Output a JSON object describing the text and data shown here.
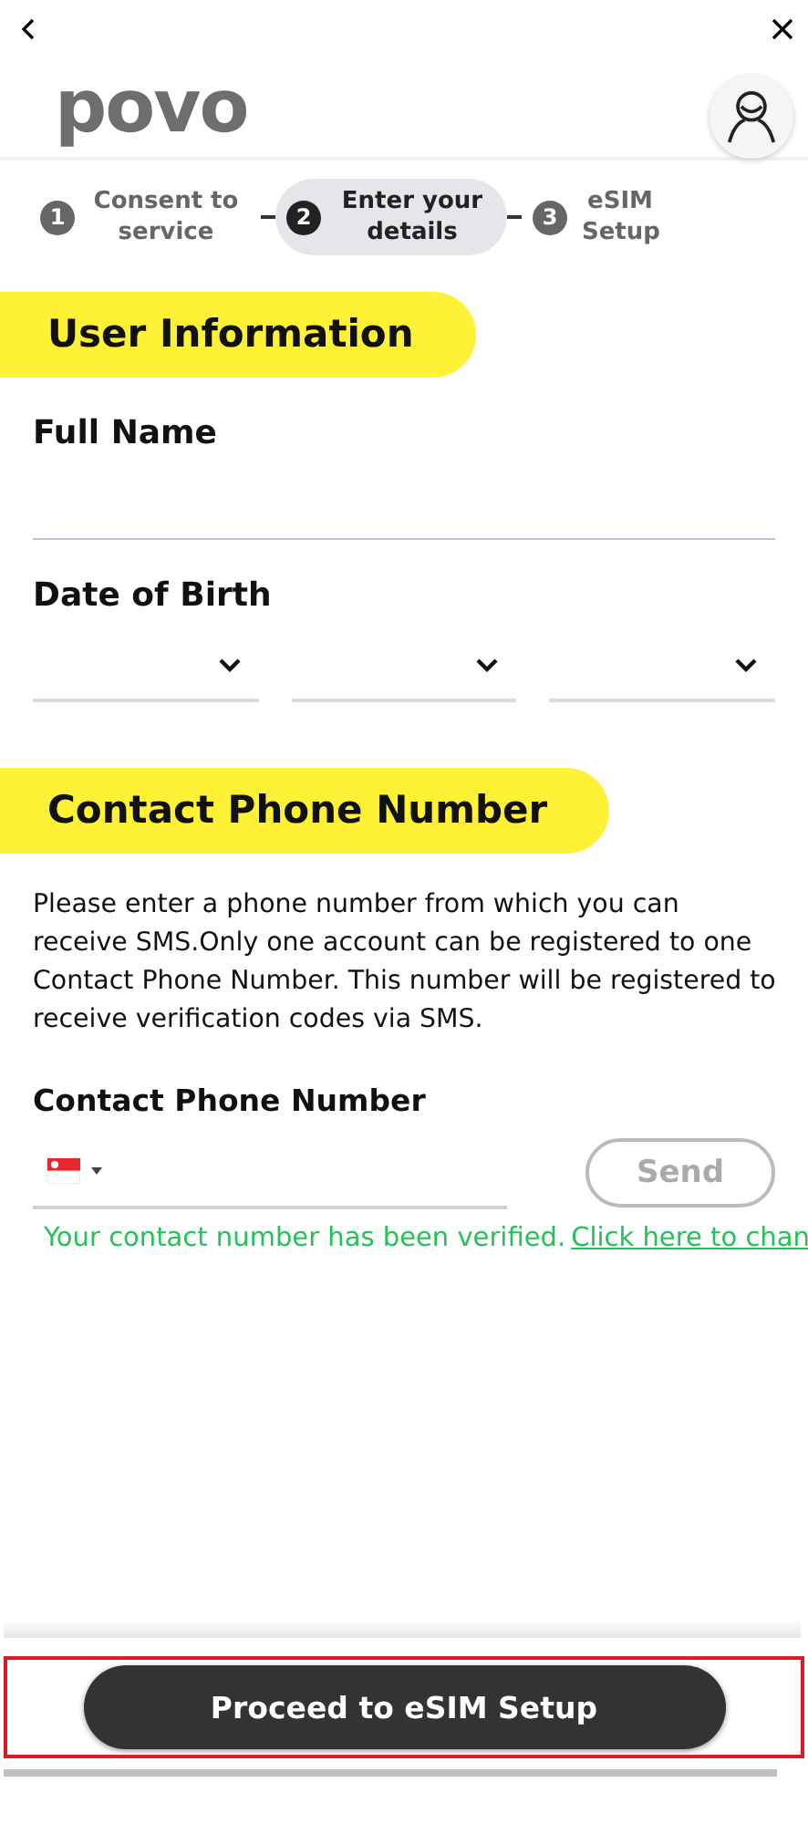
{
  "logo": "povo",
  "steps": [
    {
      "number": "1",
      "label": "Consent to service",
      "selected": false
    },
    {
      "number": "2",
      "label": "Enter your details",
      "selected": true
    },
    {
      "number": "3",
      "label": "eSIM Setup",
      "selected": false
    }
  ],
  "sections": [
    {
      "title": "User Information"
    },
    {
      "title": "Contact Phone Number"
    }
  ],
  "full_name": {
    "label": "Full Name"
  },
  "date_of_birth": {
    "label": "Date of Birth"
  },
  "contact": {
    "description": "Please enter a phone number from which you can receive SMS.Only one account can be registered to one Contact Phone Number. This number will be registered to receive verification codes via SMS.",
    "label": "Contact Phone Number",
    "send_button": "Send",
    "send_disabled": true,
    "verified": true,
    "verified_text": "Your contact number has been verified.",
    "change_link": "Click here to chan"
  },
  "proceed_button": "Proceed to eSIM Setup"
}
